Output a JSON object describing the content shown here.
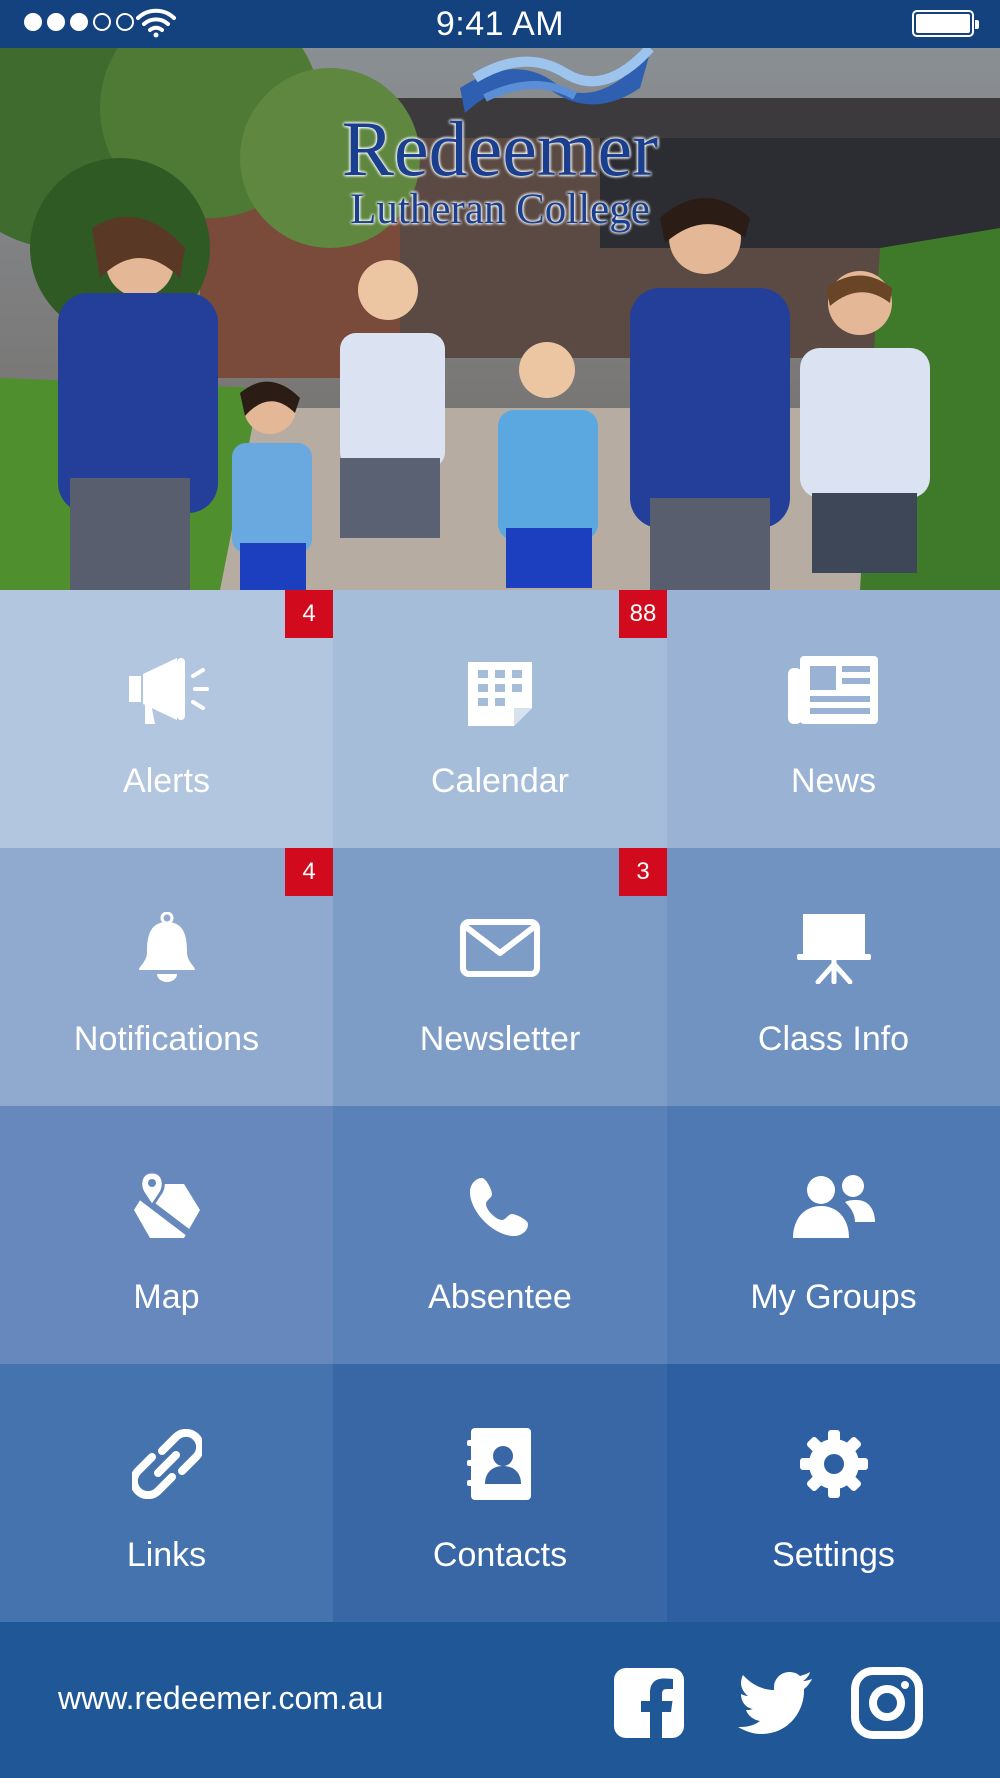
{
  "status_bar": {
    "time": "9:41 AM",
    "signal_bars_filled": 3,
    "signal_bars_total": 5,
    "battery_level": 1.0
  },
  "header": {
    "logo_name": "Redeemer",
    "logo_subtitle": "Lutheran College"
  },
  "tiles": [
    {
      "label": "Alerts",
      "icon": "megaphone-icon",
      "badge": "4",
      "color": "#b2c6df"
    },
    {
      "label": "Calendar",
      "icon": "calendar-icon",
      "badge": "88",
      "color": "#a6bdd9"
    },
    {
      "label": "News",
      "icon": "newspaper-icon",
      "badge": "",
      "color": "#9ab3d4"
    },
    {
      "label": "Notifications",
      "icon": "bell-icon",
      "badge": "4",
      "color": "#90aacf"
    },
    {
      "label": "Newsletter",
      "icon": "envelope-icon",
      "badge": "3",
      "color": "#7d9cc6"
    },
    {
      "label": "Class Info",
      "icon": "presentation-board-icon",
      "badge": "",
      "color": "#7193c1"
    },
    {
      "label": "Map",
      "icon": "map-marker-icon",
      "badge": "",
      "color": "#6688bc"
    },
    {
      "label": "Absentee",
      "icon": "phone-icon",
      "badge": "",
      "color": "#5b82b8"
    },
    {
      "label": "My Groups",
      "icon": "users-icon",
      "badge": "",
      "color": "#4f79b2"
    },
    {
      "label": "Links",
      "icon": "link-icon",
      "badge": "",
      "color": "#4473ad"
    },
    {
      "label": "Contacts",
      "icon": "address-book-icon",
      "badge": "",
      "color": "#3966a5"
    },
    {
      "label": "Settings",
      "icon": "gear-icon",
      "badge": "",
      "color": "#2e5fa2"
    }
  ],
  "footer": {
    "website": "www.redeemer.com.au",
    "social": [
      "facebook-icon",
      "twitter-icon",
      "instagram-icon"
    ]
  },
  "colors": {
    "status_bar": "#13427f",
    "footer": "#1f5797",
    "badge": "#d20a1e",
    "logo_text": "#1b3f8f"
  }
}
